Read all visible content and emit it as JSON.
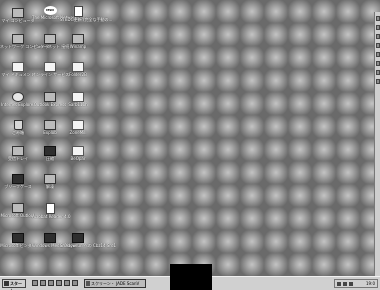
{
  "desktop": {
    "icons": [
      {
        "label": "マイ コンピュータ",
        "icon": "computer-icon"
      },
      {
        "label": "The Microsoft Network に...",
        "icon": "msn-icon"
      },
      {
        "label": "STEDG更新 (完全な手動の...",
        "icon": "document-icon"
      },
      {
        "label": "ネットワーク コンピュータ",
        "icon": "network-icon"
      },
      {
        "label": "インターネット 接続",
        "icon": "internet-connection-icon"
      },
      {
        "label": "Winamp",
        "icon": "winamp-icon"
      },
      {
        "label": "マイ ドキュメント",
        "icon": "folder-icon"
      },
      {
        "label": "オンライン サービス",
        "icon": "online-services-folder-icon"
      },
      {
        "label": "Folder2B",
        "icon": "folder-icon"
      },
      {
        "label": "Internet Explorer",
        "icon": "internet-explorer-icon"
      },
      {
        "label": "Outlook Express",
        "icon": "outlook-express-icon"
      },
      {
        "label": "Sarb111h",
        "icon": "folder-icon"
      },
      {
        "label": "ごみ箱",
        "icon": "recycle-bin-icon"
      },
      {
        "label": "Explob",
        "icon": "explorer-icon"
      },
      {
        "label": "ZoneMill",
        "icon": "folder-icon"
      },
      {
        "label": "受信トレイ",
        "icon": "inbox-icon"
      },
      {
        "label": "圧縮",
        "icon": "compress-icon"
      },
      {
        "label": "BeOpar",
        "icon": "folder-icon"
      },
      {
        "label": "ブリーフケース",
        "icon": "briefcase-icon"
      },
      {
        "label": "解凍",
        "icon": "extract-icon"
      },
      {
        "label": "Microsoft Outlook",
        "icon": "outlook-icon"
      },
      {
        "label": "Acrobat Reader 4.0",
        "icon": "acrobat-reader-icon"
      },
      {
        "label": "Microsoft ビンダー",
        "icon": "binder-icon"
      },
      {
        "label": "Windows Media Player",
        "icon": "media-player-icon"
      },
      {
        "label": "Shadowrun への Cbz14 Srd1",
        "icon": "shortcut-icon"
      }
    ]
  },
  "taskbar": {
    "start_label": "スタート",
    "quick_launch": [
      "desktop-icon",
      "ie-icon",
      "outlook-icon",
      "channel-icon",
      "app-icon",
      "app-icon"
    ],
    "task_label": "スクリーン・ JADE ScanV",
    "tray_icons": [
      "volume-icon",
      "network-icon",
      "ime-icon"
    ],
    "clock": "19:0"
  },
  "colors": {
    "taskbar": "#d0d0d0",
    "desktop": "#8c8c8c"
  }
}
